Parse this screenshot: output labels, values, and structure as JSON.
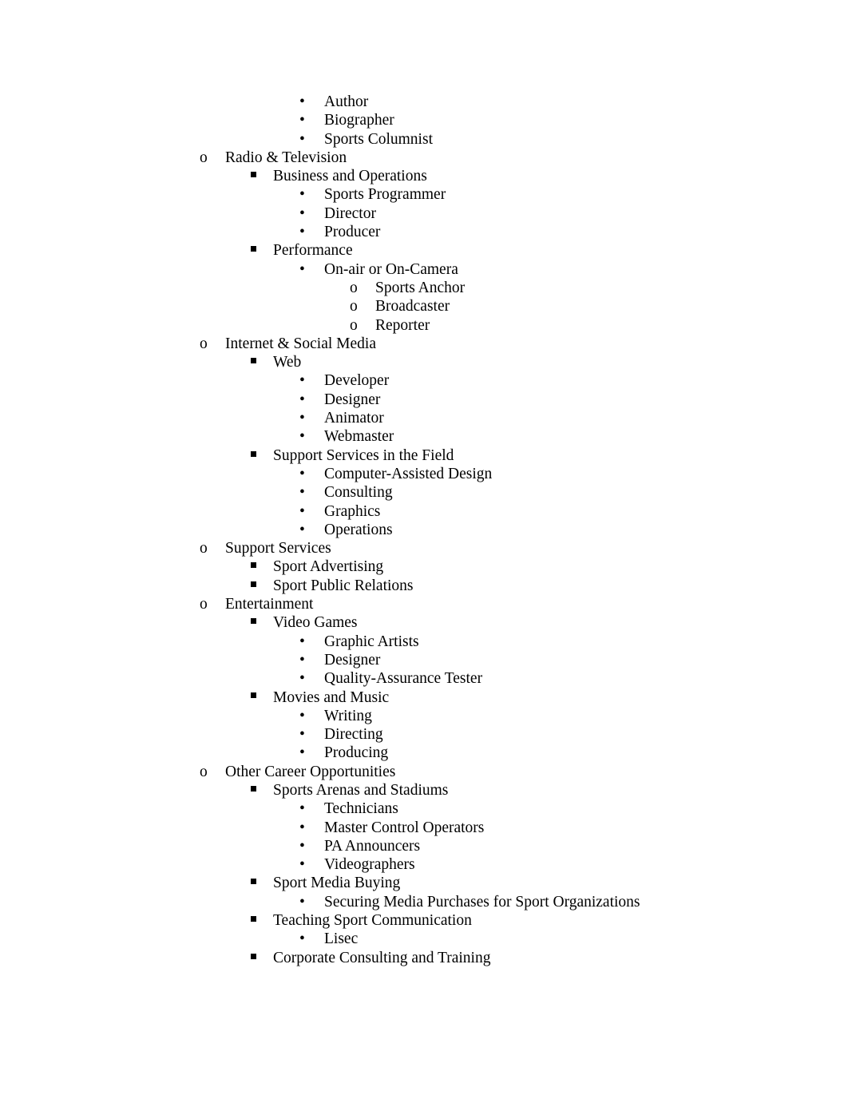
{
  "document": {
    "page_background": "#ffffff",
    "text_color": "#000000",
    "markers": {
      "level1": "o",
      "level2": "square-bullet",
      "level3": "•",
      "level4": "o"
    }
  },
  "outline": {
    "items": [
      {
        "level": 3,
        "marker": "•",
        "text": "Author"
      },
      {
        "level": 3,
        "marker": "•",
        "text": "Biographer"
      },
      {
        "level": 3,
        "marker": "•",
        "text": "Sports Columnist"
      },
      {
        "level": 1,
        "marker": "o",
        "text": "Radio & Television"
      },
      {
        "level": 2,
        "marker": "square-bullet",
        "text": "Business and Operations"
      },
      {
        "level": 3,
        "marker": "•",
        "text": "Sports Programmer"
      },
      {
        "level": 3,
        "marker": "•",
        "text": "Director"
      },
      {
        "level": 3,
        "marker": "•",
        "text": "Producer"
      },
      {
        "level": 2,
        "marker": "square-bullet",
        "text": "Performance"
      },
      {
        "level": 3,
        "marker": "•",
        "text": "On-air or On-Camera"
      },
      {
        "level": 4,
        "marker": "o",
        "text": "Sports Anchor"
      },
      {
        "level": 4,
        "marker": "o",
        "text": "Broadcaster"
      },
      {
        "level": 4,
        "marker": "o",
        "text": "Reporter"
      },
      {
        "level": 1,
        "marker": "o",
        "text": "Internet & Social Media"
      },
      {
        "level": 2,
        "marker": "square-bullet",
        "text": "Web"
      },
      {
        "level": 3,
        "marker": "•",
        "text": "Developer"
      },
      {
        "level": 3,
        "marker": "•",
        "text": "Designer"
      },
      {
        "level": 3,
        "marker": "•",
        "text": "Animator"
      },
      {
        "level": 3,
        "marker": "•",
        "text": "Webmaster"
      },
      {
        "level": 2,
        "marker": "square-bullet",
        "text": "Support Services in the Field"
      },
      {
        "level": 3,
        "marker": "•",
        "text": "Computer-Assisted Design"
      },
      {
        "level": 3,
        "marker": "•",
        "text": "Consulting"
      },
      {
        "level": 3,
        "marker": "•",
        "text": "Graphics"
      },
      {
        "level": 3,
        "marker": "•",
        "text": "Operations"
      },
      {
        "level": 1,
        "marker": "o",
        "text": "Support Services"
      },
      {
        "level": 2,
        "marker": "square-bullet",
        "text": "Sport Advertising"
      },
      {
        "level": 2,
        "marker": "square-bullet",
        "text": "Sport Public Relations"
      },
      {
        "level": 1,
        "marker": "o",
        "text": "Entertainment"
      },
      {
        "level": 2,
        "marker": "square-bullet",
        "text": "Video Games"
      },
      {
        "level": 3,
        "marker": "•",
        "text": "Graphic Artists"
      },
      {
        "level": 3,
        "marker": "•",
        "text": "Designer"
      },
      {
        "level": 3,
        "marker": "•",
        "text": "Quality-Assurance Tester"
      },
      {
        "level": 2,
        "marker": "square-bullet",
        "text": "Movies and Music"
      },
      {
        "level": 3,
        "marker": "•",
        "text": "Writing"
      },
      {
        "level": 3,
        "marker": "•",
        "text": "Directing"
      },
      {
        "level": 3,
        "marker": "•",
        "text": "Producing"
      },
      {
        "level": 1,
        "marker": "o",
        "text": "Other Career Opportunities"
      },
      {
        "level": 2,
        "marker": "square-bullet",
        "text": "Sports Arenas and Stadiums"
      },
      {
        "level": 3,
        "marker": "•",
        "text": "Technicians"
      },
      {
        "level": 3,
        "marker": "•",
        "text": "Master Control Operators"
      },
      {
        "level": 3,
        "marker": "•",
        "text": "PA Announcers"
      },
      {
        "level": 3,
        "marker": "•",
        "text": "Videographers"
      },
      {
        "level": 2,
        "marker": "square-bullet",
        "text": "Sport Media Buying"
      },
      {
        "level": 3,
        "marker": "•",
        "text": "Securing Media Purchases for Sport Organizations"
      },
      {
        "level": 2,
        "marker": "square-bullet",
        "text": "Teaching Sport Communication"
      },
      {
        "level": 3,
        "marker": "•",
        "text": "Lisec"
      },
      {
        "level": 2,
        "marker": "square-bullet",
        "text": "Corporate Consulting and Training"
      }
    ]
  }
}
